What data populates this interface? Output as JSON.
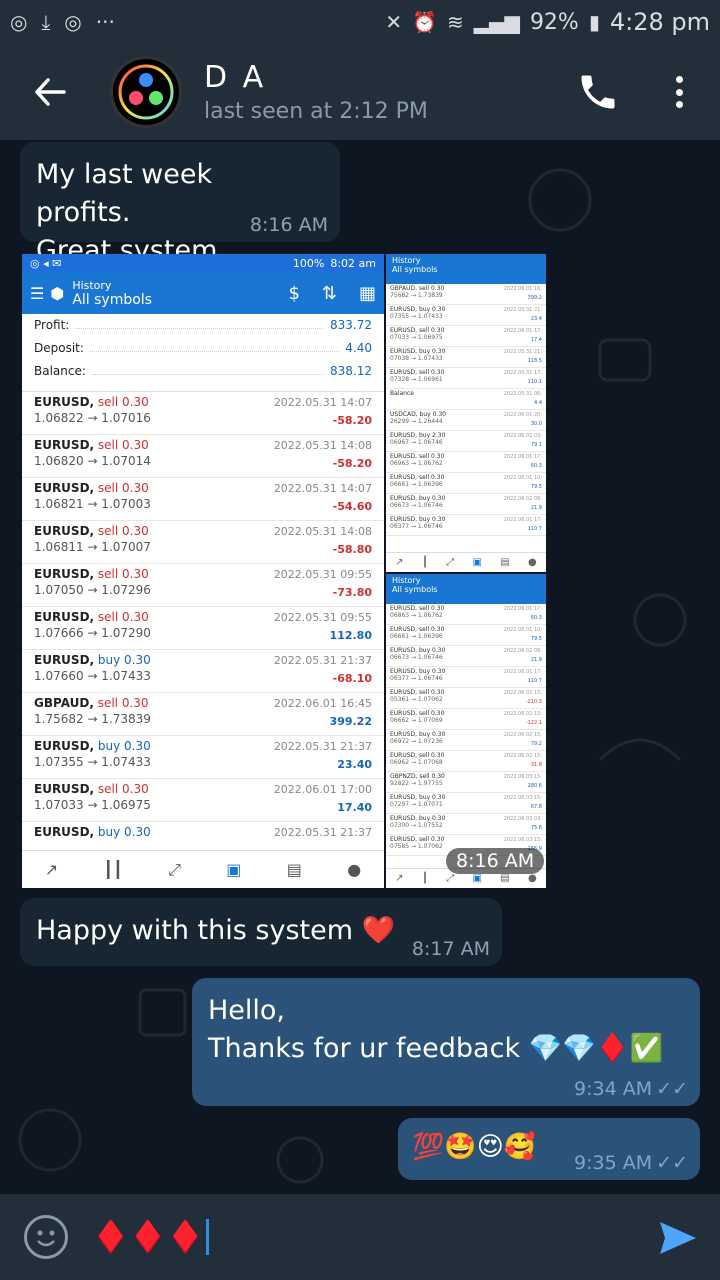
{
  "status_bar": {
    "battery": "92%",
    "time": "4:28 pm"
  },
  "header": {
    "name": "D A",
    "last_seen": "last seen at 2:12 PM"
  },
  "messages": {
    "m1": {
      "text": "My last week profits.\nGreat system",
      "time": "8:16 AM"
    },
    "img_time": "8:16 AM",
    "m2": {
      "text": "Happy with this system ❤️",
      "time": "8:17 AM"
    },
    "m3": {
      "text": "Hello,\nThanks for ur feedback 💎💎♦️✅",
      "time": "9:34 AM"
    },
    "m4": {
      "text": "💯🤩😍🥰",
      "time": "9:35 AM"
    }
  },
  "screenshot": {
    "status_battery": "100%",
    "status_time": "8:02 am",
    "title_small": "History",
    "title": "All symbols",
    "summary": [
      {
        "label": "Profit:",
        "value": "833.72"
      },
      {
        "label": "Deposit:",
        "value": "4.40"
      },
      {
        "label": "Balance:",
        "value": "838.12"
      }
    ],
    "trades": [
      {
        "sym": "EURUSD,",
        "side": "sell 0.30",
        "kind": "sell",
        "prices": "1.06822 → 1.07016",
        "date": "2022.05.31 14:07",
        "pnl": "-58.20",
        "neg": true
      },
      {
        "sym": "EURUSD,",
        "side": "sell 0.30",
        "kind": "sell",
        "prices": "1.06820 → 1.07014",
        "date": "2022.05.31 14:08",
        "pnl": "-58.20",
        "neg": true
      },
      {
        "sym": "EURUSD,",
        "side": "sell 0.30",
        "kind": "sell",
        "prices": "1.06821 → 1.07003",
        "date": "2022.05.31 14:07",
        "pnl": "-54.60",
        "neg": true
      },
      {
        "sym": "EURUSD,",
        "side": "sell 0.30",
        "kind": "sell",
        "prices": "1.06811 → 1.07007",
        "date": "2022.05.31 14:08",
        "pnl": "-58.80",
        "neg": true
      },
      {
        "sym": "EURUSD,",
        "side": "sell 0.30",
        "kind": "sell",
        "prices": "1.07050 → 1.07296",
        "date": "2022.05.31 09:55",
        "pnl": "-73.80",
        "neg": true
      },
      {
        "sym": "EURUSD,",
        "side": "sell 0.30",
        "kind": "sell",
        "prices": "1.07666 → 1.07290",
        "date": "2022.05.31 09:55",
        "pnl": "112.80",
        "neg": false
      },
      {
        "sym": "EURUSD,",
        "side": "buy 0.30",
        "kind": "buy",
        "prices": "1.07660 → 1.07433",
        "date": "2022.05.31 21:37",
        "pnl": "-68.10",
        "neg": true
      },
      {
        "sym": "GBPAUD,",
        "side": "sell 0.30",
        "kind": "sell",
        "prices": "1.75682 → 1.73839",
        "date": "2022.06.01 16:45",
        "pnl": "399.22",
        "neg": false
      },
      {
        "sym": "EURUSD,",
        "side": "buy 0.30",
        "kind": "buy",
        "prices": "1.07355 → 1.07433",
        "date": "2022.05.31 21:37",
        "pnl": "23.40",
        "neg": false
      },
      {
        "sym": "EURUSD,",
        "side": "sell 0.30",
        "kind": "sell",
        "prices": "1.07033 → 1.06975",
        "date": "2022.06.01 17:00",
        "pnl": "17.40",
        "neg": false
      },
      {
        "sym": "EURUSD,",
        "side": "buy 0.30",
        "kind": "buy",
        "prices": "",
        "date": "2022.05.31 21:37",
        "pnl": "",
        "neg": false
      }
    ]
  },
  "mini1": {
    "title_small": "History",
    "title": "All symbols",
    "rows": [
      {
        "a": "GBPAUD, sell 0.30",
        "b": "75682 → 1.73839",
        "d": "2022.06.01 16:",
        "p": "399.2",
        "neg": false
      },
      {
        "a": "EURUSD, buy 0.30",
        "b": "07355 → 1.07433",
        "d": "2022.05.31 21:",
        "p": "23.4",
        "neg": false
      },
      {
        "a": "EURUSD, sell 0.30",
        "b": "07033 → 1.06975",
        "d": "2022.06.01 17:",
        "p": "17.4",
        "neg": false
      },
      {
        "a": "EURUSD, buy 0.30",
        "b": "07038 → 1.07433",
        "d": "2022.05.31 21:",
        "p": "118.5",
        "neg": false
      },
      {
        "a": "EURUSD, sell 0.30",
        "b": "07328 → 1.06961",
        "d": "2022.05.31 17:",
        "p": "110.1",
        "neg": false
      },
      {
        "a": "Balance",
        "b": "",
        "d": "2022.05.31 06:",
        "p": "4.4",
        "neg": false
      },
      {
        "a": "USDCAD, buy 0.30",
        "b": "26299 → 1.26444",
        "d": "2022.06.01 20:",
        "p": "30.0",
        "neg": false
      },
      {
        "a": "EURUSD, buy 2.30",
        "b": "06967 → 1.06746",
        "d": "2022.06.02 03:",
        "p": "79.1",
        "neg": false
      },
      {
        "a": "EURUSD, sell 0.30",
        "b": "06963 → 1.06762",
        "d": "2022.06.01 17:",
        "p": "60.3",
        "neg": false
      },
      {
        "a": "EURUSD, sell 0.30",
        "b": "06661 → 1.06396",
        "d": "2022.06.01 10:",
        "p": "79.5",
        "neg": false
      },
      {
        "a": "EURUSD, buy 0.30",
        "b": "06673 → 1.06746",
        "d": "2022.06.02 09:",
        "p": "21.9",
        "neg": false
      },
      {
        "a": "EURUSD, buy 0.30",
        "b": "06377 → 1.06746",
        "d": "2022.06.01 17:",
        "p": "110.7",
        "neg": false
      }
    ]
  },
  "mini2": {
    "title_small": "History",
    "title": "All symbols",
    "rows": [
      {
        "a": "EURUSD, sell 0.30",
        "b": "06863 → 1.06762",
        "d": "2022.06.01 17:",
        "p": "60.3",
        "neg": false
      },
      {
        "a": "EURUSD, sell 0.30",
        "b": "06661 → 1.06396",
        "d": "2022.06.01 10:",
        "p": "79.5",
        "neg": false
      },
      {
        "a": "EURUSD, buy 0.30",
        "b": "06673 → 1.06746",
        "d": "2022.06.02 09:",
        "p": "21.9",
        "neg": false
      },
      {
        "a": "EURUSD, buy 0.30",
        "b": "06377 → 1.06746",
        "d": "2022.06.01 17:",
        "p": "110.7",
        "neg": false
      },
      {
        "a": "EURUSD, sell 0.30",
        "b": "05361 → 1.07062",
        "d": "2022.06.02 15:",
        "p": "-210.3",
        "neg": true
      },
      {
        "a": "EURUSD, sell 0.30",
        "b": "06662 → 1.07069",
        "d": "2022.06.02 15:",
        "p": "-122.1",
        "neg": true
      },
      {
        "a": "EURUSD, buy 0.30",
        "b": "06972 → 1.07236",
        "d": "2022.06.02 15:",
        "p": "79.2",
        "neg": false
      },
      {
        "a": "EURUSD, sell 0.30",
        "b": "06962 → 1.07068",
        "d": "2022.06.02 15:",
        "p": "-31.8",
        "neg": true
      },
      {
        "a": "GBPNZD, sell 0.30",
        "b": "92822 → 1.97755",
        "d": "2022.06.03 15:",
        "p": "280.6",
        "neg": false
      },
      {
        "a": "EURUSD, buy 0.30",
        "b": "07297 → 1.07071",
        "d": "2022.06.03 15:",
        "p": "67.8",
        "neg": false
      },
      {
        "a": "EURUSD, buy 0.30",
        "b": "07300 → 1.07552",
        "d": "2022.06.03 03:",
        "p": "75.6",
        "neg": false
      },
      {
        "a": "EURUSD, sell 0.30",
        "b": "07585 → 1.07062",
        "d": "2022.06.03 15:",
        "p": "156.9",
        "neg": false
      }
    ]
  },
  "input": {
    "value": "♦️♦️♦️"
  }
}
